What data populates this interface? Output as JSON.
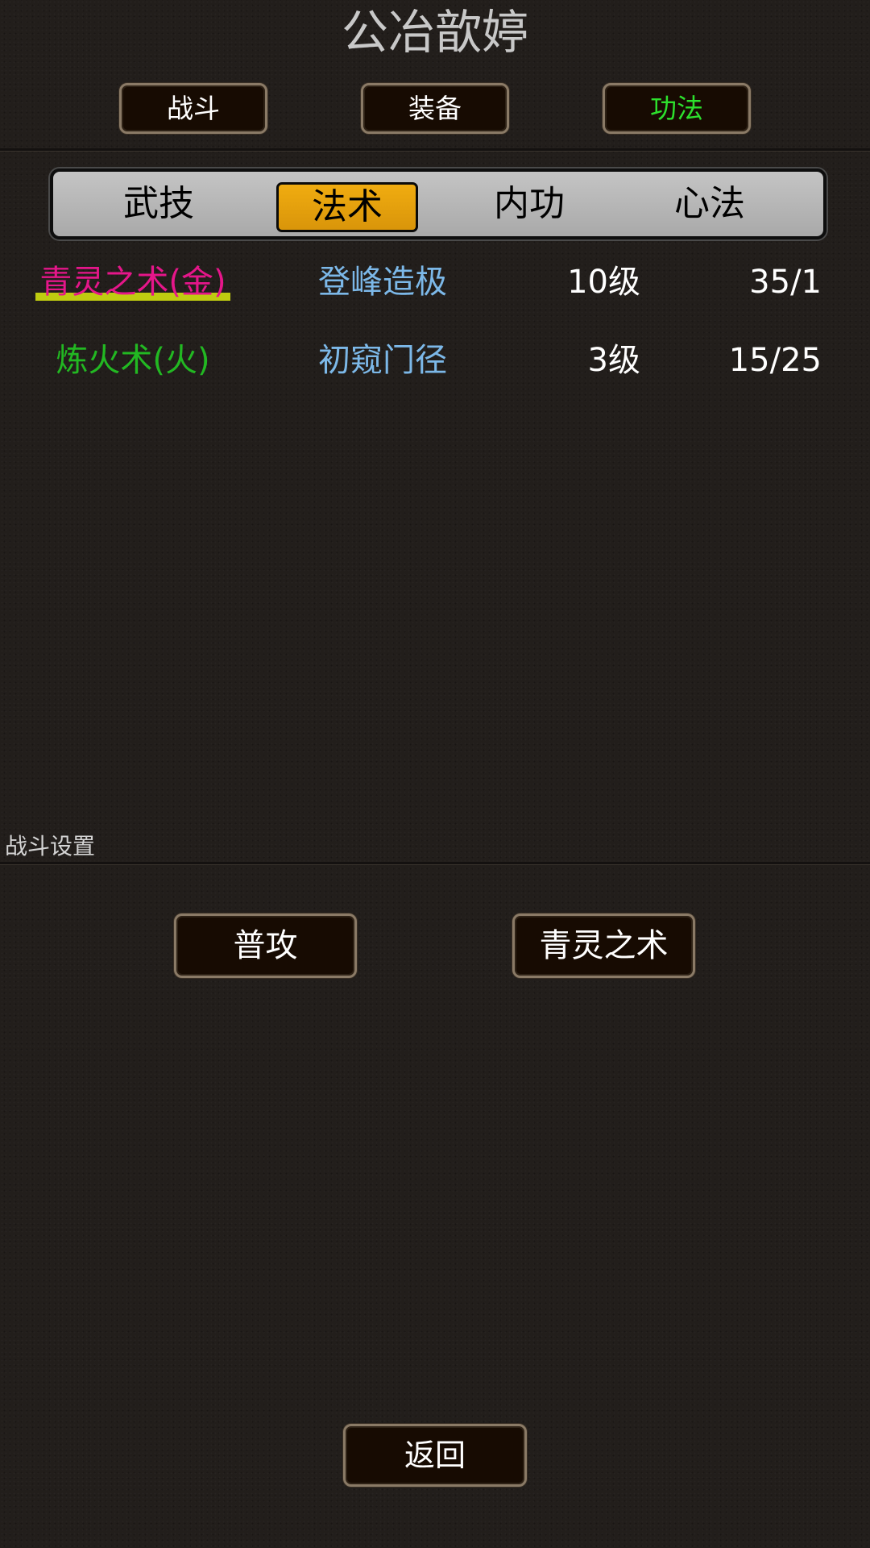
{
  "title": "公冶歆婷",
  "top_tabs": [
    {
      "label": "战斗",
      "active": false
    },
    {
      "label": "装备",
      "active": false
    },
    {
      "label": "功法",
      "active": true
    }
  ],
  "sub_tabs": [
    {
      "label": "武技",
      "active": false
    },
    {
      "label": "法术",
      "active": true
    },
    {
      "label": "内功",
      "active": false
    },
    {
      "label": "心法",
      "active": false
    }
  ],
  "skills": [
    {
      "name": "青灵之术(金)",
      "rank": "登峰造极",
      "level": "10级",
      "progress": "35/1",
      "name_color": "#e5168a",
      "selected": true
    },
    {
      "name": "炼火术(火)",
      "rank": "初窥门径",
      "level": "3级",
      "progress": "15/25",
      "name_color": "#22b822",
      "selected": false
    }
  ],
  "battle_settings": {
    "label": "战斗设置",
    "buttons": [
      "普攻",
      "青灵之术"
    ]
  },
  "back_label": "返回",
  "colors": {
    "active_tab_text": "#2de02d",
    "active_subtab_bg": "#e3a00c",
    "rank_text": "#7cb8e8",
    "selection_highlight": "#bfcc10"
  }
}
